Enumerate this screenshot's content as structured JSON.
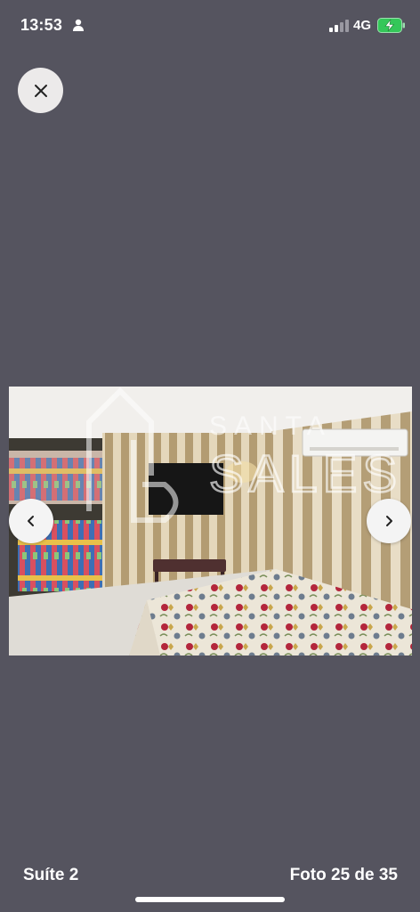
{
  "status_bar": {
    "time": "13:53",
    "network": "4G",
    "icons": [
      "person-icon",
      "signal-icon",
      "battery-charging-icon"
    ]
  },
  "viewer": {
    "close_icon": "close-icon",
    "prev_icon": "chevron-left-icon",
    "next_icon": "chevron-right-icon",
    "photo": {
      "description_icon": "bedroom-photo",
      "watermark_text_line1": "SANTA",
      "watermark_text_line2": "SALES"
    }
  },
  "footer": {
    "room_label": "Suíte 2",
    "photo_counter": "Foto 25 de 35"
  },
  "colors": {
    "background": "#55545f",
    "button_bg": "#eceaea",
    "text": "#ffffff",
    "battery_green": "#34c759"
  }
}
